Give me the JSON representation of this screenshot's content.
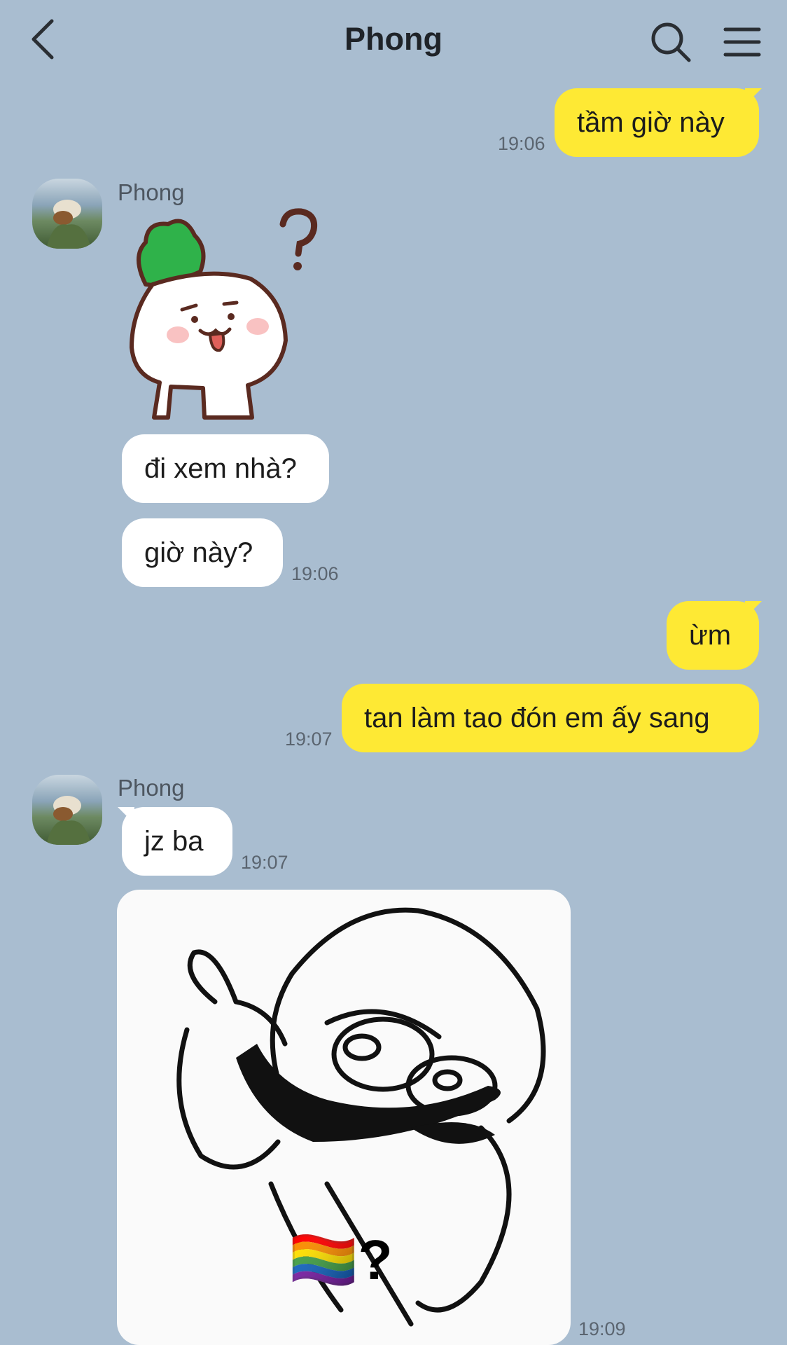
{
  "header": {
    "title": "Phong"
  },
  "messages": [
    {
      "side": "me",
      "text": "tầm giờ này",
      "time": "19:06"
    },
    {
      "side": "them",
      "sender": "Phong",
      "sticker": "radish-question-sticker"
    },
    {
      "side": "them",
      "text": "đi xem nhà?"
    },
    {
      "side": "them",
      "text": "giờ này?",
      "time": "19:06"
    },
    {
      "side": "me",
      "text": "ừm"
    },
    {
      "side": "me",
      "text": "tan làm tao đón em ấy sang",
      "time": "19:07"
    },
    {
      "side": "them",
      "sender": "Phong",
      "text": "jz ba",
      "time": "19:07"
    },
    {
      "side": "them",
      "image": "meme-thumbs-up",
      "caption": "🏳️‍🌈?",
      "time": "19:09"
    }
  ],
  "colors": {
    "background": "#a9bdd0",
    "my_bubble": "#fee934",
    "their_bubble": "#ffffff"
  },
  "icons": {
    "back": "chevron-left-icon",
    "search": "search-icon",
    "menu": "hamburger-menu-icon"
  }
}
